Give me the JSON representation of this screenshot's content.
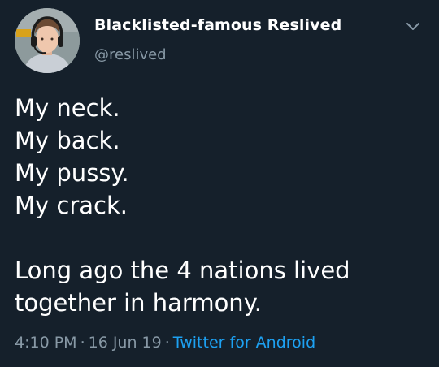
{
  "tweet": {
    "author_name": "Blacklisted-famous Reslived",
    "author_handle": "@reslived",
    "avatar_icon": "profile-photo",
    "menu_icon": "chevron-down-icon",
    "lines": [
      "My neck.",
      "My back.",
      "My pussy.",
      "My crack."
    ],
    "paragraph": [
      "Long ago the 4 nations lived",
      "together in harmony."
    ],
    "time": "4:10 PM",
    "separator": "·",
    "date": "16 Jun 19",
    "source": "Twitter for Android"
  },
  "colors": {
    "background": "#15202b",
    "primary_text": "#ffffff",
    "secondary_text": "#8899a6",
    "link": "#1da1f2"
  }
}
